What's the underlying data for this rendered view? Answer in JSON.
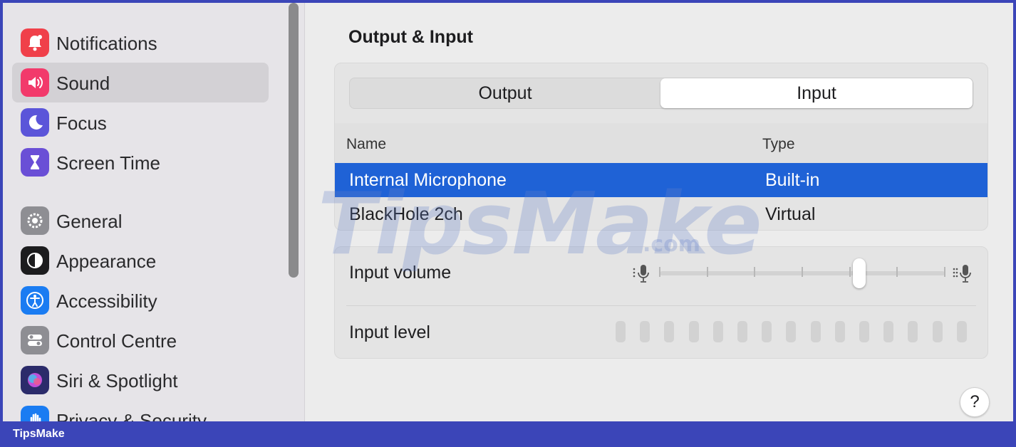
{
  "sidebar": {
    "items": [
      {
        "label": "Notifications",
        "icon": "bell-icon",
        "color": "#f0404a"
      },
      {
        "label": "Sound",
        "icon": "speaker-icon",
        "color": "#f23a6b"
      },
      {
        "label": "Focus",
        "icon": "moon-icon",
        "color": "#5b55d9"
      },
      {
        "label": "Screen Time",
        "icon": "hourglass-icon",
        "color": "#6a4fd6"
      },
      {
        "label": "General",
        "icon": "gear-icon",
        "color": "#8e8e93"
      },
      {
        "label": "Appearance",
        "icon": "appearance-icon",
        "color": "#1c1c1e"
      },
      {
        "label": "Accessibility",
        "icon": "accessibility-icon",
        "color": "#1a7cf2"
      },
      {
        "label": "Control Centre",
        "icon": "toggles-icon",
        "color": "#8e8e93"
      },
      {
        "label": "Siri & Spotlight",
        "icon": "siri-icon",
        "color": "#2b2b6a"
      },
      {
        "label": "Privacy & Security",
        "icon": "hand-icon",
        "color": "#1a7cf2"
      }
    ],
    "selected": "Sound"
  },
  "main": {
    "title": "Output & Input",
    "tabs": [
      {
        "label": "Output",
        "active": false
      },
      {
        "label": "Input",
        "active": true
      }
    ],
    "table": {
      "columns": [
        "Name",
        "Type"
      ],
      "rows": [
        {
          "name": "Internal Microphone",
          "type": "Built-in",
          "selected": true
        },
        {
          "name": "BlackHole 2ch",
          "type": "Virtual",
          "selected": false
        }
      ]
    },
    "input_volume": {
      "label": "Input volume",
      "value": 0.7
    },
    "input_level": {
      "label": "Input level",
      "value": 0
    },
    "help_label": "?"
  },
  "watermark": {
    "text": "TipsMake",
    "suffix": ".com"
  },
  "footer": {
    "label": "TipsMake"
  },
  "colors": {
    "accent": "#1f62d6",
    "frame": "#3b45b8"
  }
}
